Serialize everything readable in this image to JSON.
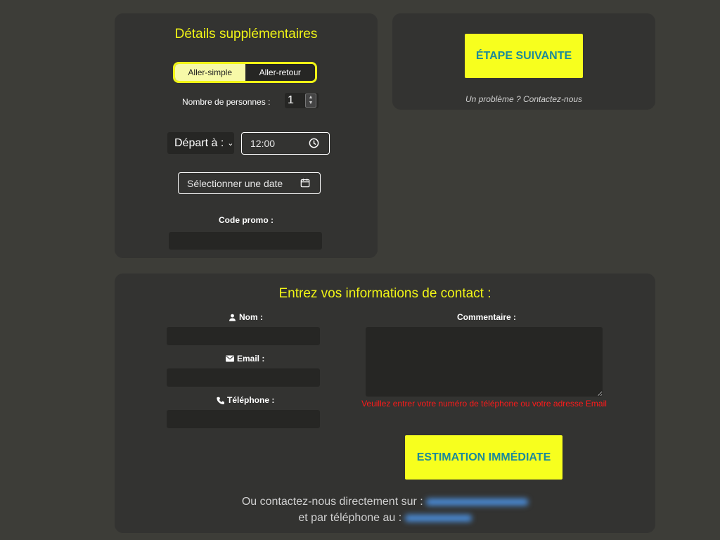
{
  "details": {
    "title": "Détails supplémentaires",
    "trip_options": [
      "Aller-simple",
      "Aller-retour"
    ],
    "people_label": "Nombre de personnes :",
    "people_value": "1",
    "depart_select": "Départ à :",
    "time_value": "12:00",
    "date_placeholder": "Sélectionner une date",
    "promo_label": "Code promo :"
  },
  "next": {
    "button_label": "ÉTAPE SUIVANTE",
    "problem_text": "Un problème ? Contactez-nous"
  },
  "contact": {
    "title": "Entrez vos informations de contact :",
    "name_label": "Nom :",
    "email_label": "Email :",
    "phone_label": "Téléphone :",
    "comment_label": "Commentaire :",
    "error_text": "Veuillez entrer votre numéro de téléphone ou votre adresse Email",
    "estimate_button": "ESTIMATION IMMÉDIATE",
    "direct_line": "Ou contactez-nous directement sur :",
    "phone_line": "et par téléphone au :"
  },
  "colors": {
    "accent": "#f1f516",
    "button_text": "#1c8a9a",
    "error": "#ff1a1a",
    "background": "#3d3d38",
    "card": "#333331"
  }
}
